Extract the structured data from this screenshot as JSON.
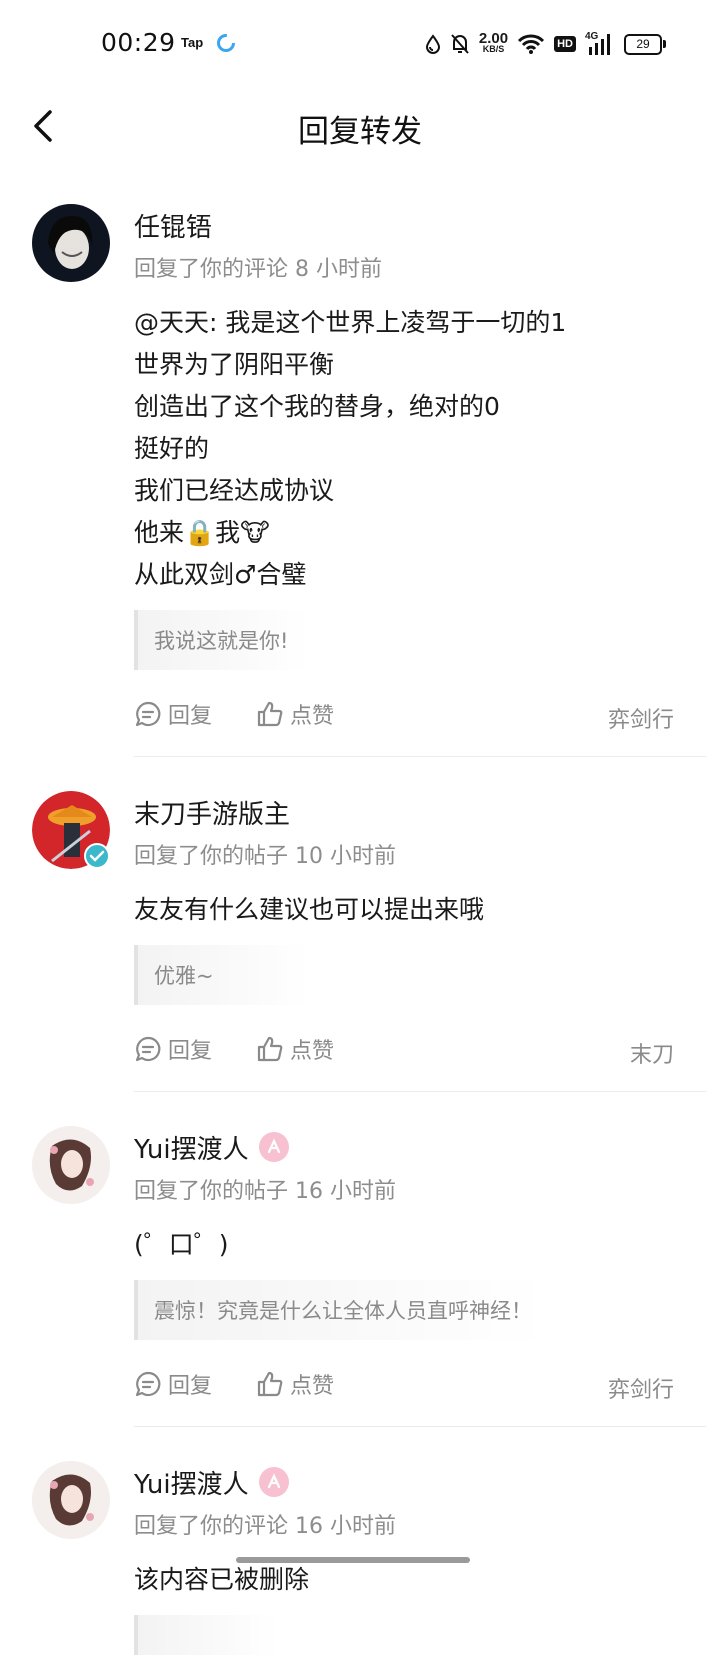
{
  "status_bar": {
    "time": "00:29",
    "tap_label": "Tap",
    "speed_value": "2.00",
    "speed_unit": "KB/S",
    "hd_label": "HD",
    "network_label": "4G",
    "battery_level": "29"
  },
  "header": {
    "title": "回复转发"
  },
  "items": [
    {
      "name": "任锟铻",
      "meta": "回复了你的评论 8 小时前",
      "content_lines": [
        "@天天: 我是这个世界上凌驾于一切的1",
        "世界为了阴阳平衡",
        "创造出了这个我的替身，绝对的0",
        "挺好的",
        "我们已经达成协议"
      ],
      "line6_a": "他来",
      "line6_emoji1": "🔒",
      "line6_b": "我",
      "line6_emoji2": "🐮",
      "line7": "从此双剑♂合璧",
      "quote": "我说这就是你!",
      "reply_label": "回复",
      "like_label": "点赞",
      "source": "弈剑行"
    },
    {
      "name": "末刀手游版主",
      "meta": "回复了你的帖子 10 小时前",
      "content": "友友有什么建议也可以提出来哦",
      "quote": "优雅~",
      "reply_label": "回复",
      "like_label": "点赞",
      "source": "末刀"
    },
    {
      "name": "Yui摆渡人",
      "meta": "回复了你的帖子 16 小时前",
      "content": "(゜口゜)",
      "quote": "震惊！究竟是什么让全体人员直呼神经！",
      "reply_label": "回复",
      "like_label": "点赞",
      "source": "弈剑行"
    },
    {
      "name": "Yui摆渡人",
      "meta": "回复了你的评论 16 小时前",
      "content": "该内容已被删除"
    }
  ],
  "colors": {
    "text_primary": "#1a1a1a",
    "text_secondary": "#8d8d8d",
    "badge_pink": "#f7c1d1",
    "verified_teal": "#3bb8c9"
  }
}
